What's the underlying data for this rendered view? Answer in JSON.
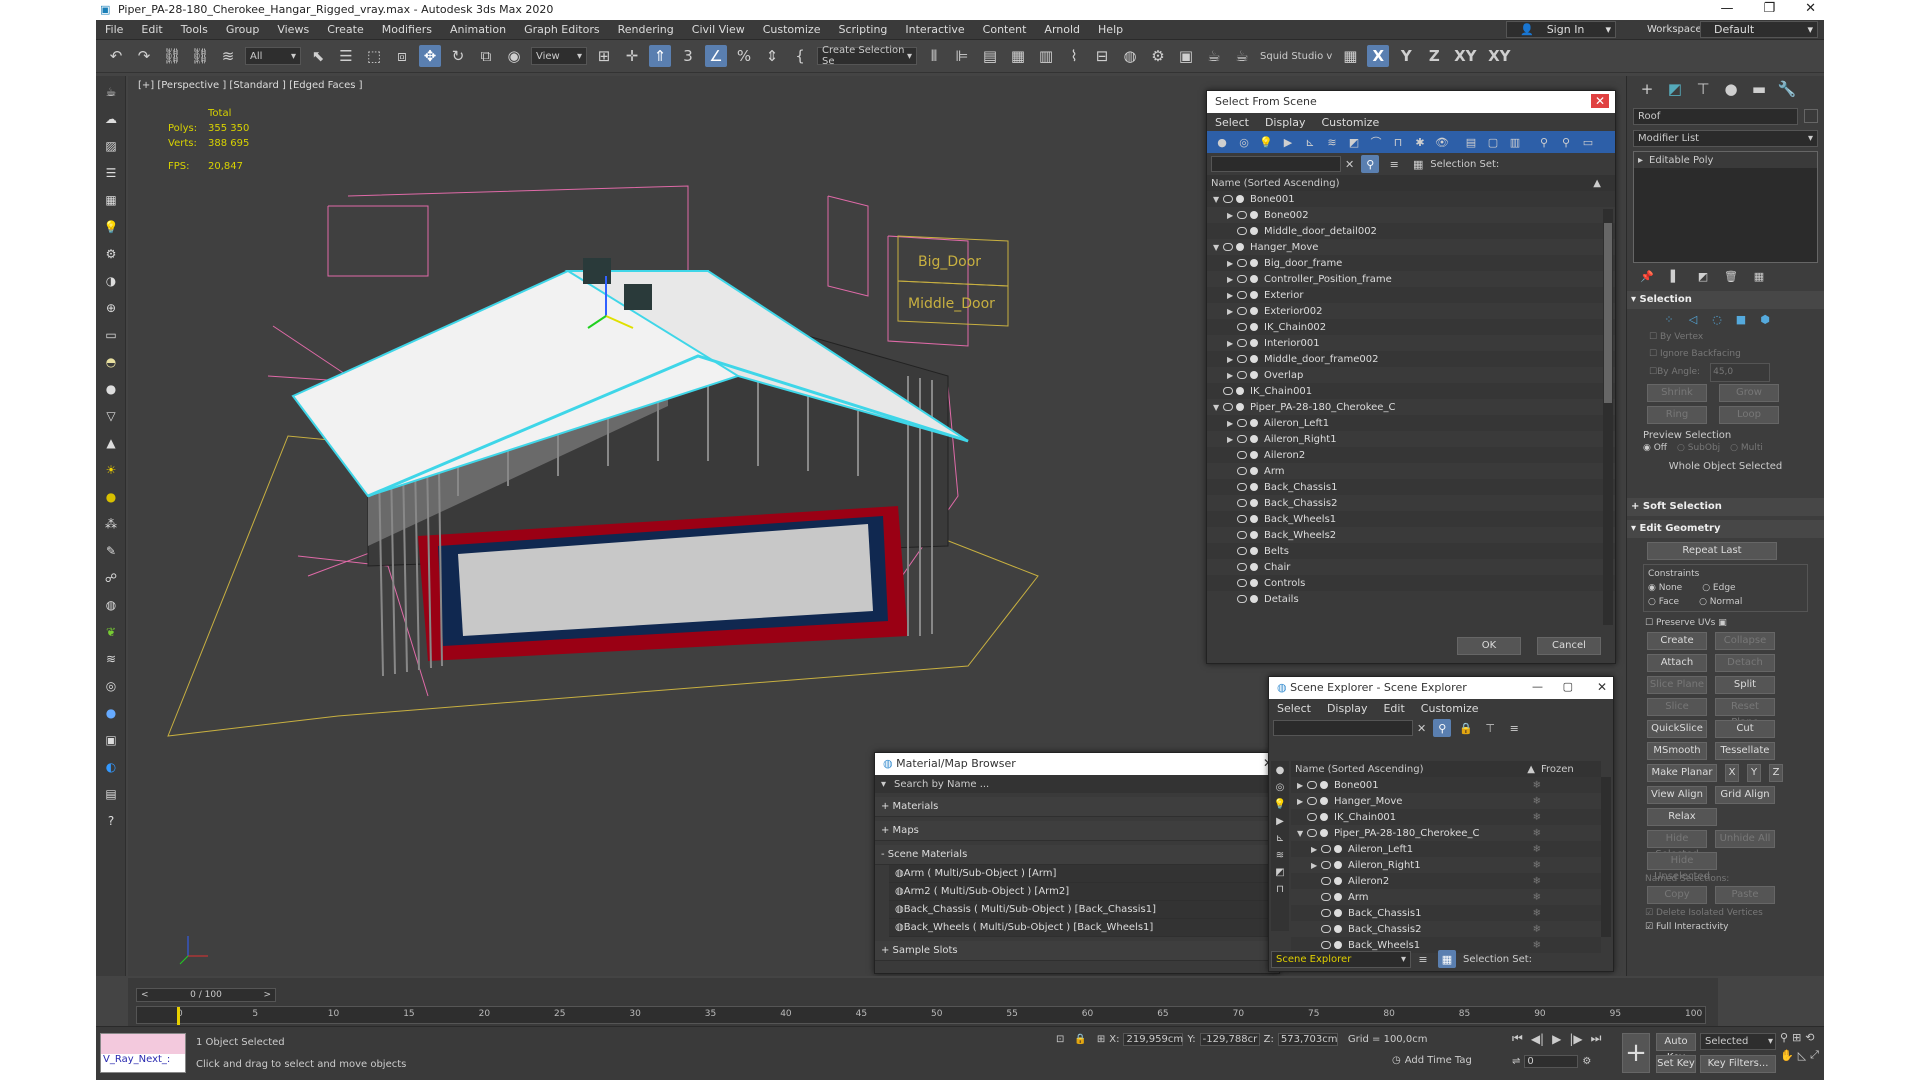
{
  "window": {
    "title": "Piper_PA-28-180_Cherokee_Hangar_Rigged_vray.max - Autodesk 3ds Max 2020"
  },
  "menu": [
    "File",
    "Edit",
    "Tools",
    "Group",
    "Views",
    "Create",
    "Modifiers",
    "Animation",
    "Graph Editors",
    "Rendering",
    "Civil View",
    "Customize",
    "Scripting",
    "Interactive",
    "Content",
    "Arnold",
    "Help"
  ],
  "signin": "Sign In",
  "workspaces_label": "Workspaces:",
  "workspace": "Default",
  "toolbar": {
    "filter": "All",
    "view": "View",
    "selection_set": "Create Selection Se",
    "squid": "Squid Studio v",
    "axes": [
      "X",
      "Y",
      "Z",
      "XY",
      "XY"
    ]
  },
  "viewport": {
    "label": "[+] [Perspective ] [Standard ] [Edged Faces ]",
    "stats_total": "Total",
    "polys_label": "Polys:",
    "polys": "355 350",
    "verts_label": "Verts:",
    "verts": "388 695",
    "fps_label": "FPS:",
    "fps": "20,847",
    "sign1": "Big_Door",
    "sign2": "Middle_Door"
  },
  "select_scene": {
    "title": "Select From Scene",
    "menu": [
      "Select",
      "Display",
      "Customize"
    ],
    "selection_set_label": "Selection Set:",
    "header": "Name (Sorted Ascending)",
    "items": [
      {
        "name": "Bone001",
        "lvl": 0,
        "exp": "open"
      },
      {
        "name": "Bone002",
        "lvl": 1,
        "exp": "closed"
      },
      {
        "name": "Middle_door_detail002",
        "lvl": 1,
        "exp": ""
      },
      {
        "name": "Hanger_Move",
        "lvl": 0,
        "exp": "open"
      },
      {
        "name": "Big_door_frame",
        "lvl": 1,
        "exp": "closed"
      },
      {
        "name": "Controller_Position_frame",
        "lvl": 1,
        "exp": "closed"
      },
      {
        "name": "Exterior",
        "lvl": 1,
        "exp": "closed"
      },
      {
        "name": "Exterior002",
        "lvl": 1,
        "exp": "closed"
      },
      {
        "name": "IK_Chain002",
        "lvl": 1,
        "exp": ""
      },
      {
        "name": "Interior001",
        "lvl": 1,
        "exp": "closed"
      },
      {
        "name": "Middle_door_frame002",
        "lvl": 1,
        "exp": "closed"
      },
      {
        "name": "Overlap",
        "lvl": 1,
        "exp": "closed"
      },
      {
        "name": "IK_Chain001",
        "lvl": 0,
        "exp": ""
      },
      {
        "name": "Piper_PA-28-180_Cherokee_C",
        "lvl": 0,
        "exp": "open"
      },
      {
        "name": "Aileron_Left1",
        "lvl": 1,
        "exp": "closed"
      },
      {
        "name": "Aileron_Right1",
        "lvl": 1,
        "exp": "closed"
      },
      {
        "name": "Aileron2",
        "lvl": 1,
        "exp": ""
      },
      {
        "name": "Arm",
        "lvl": 1,
        "exp": ""
      },
      {
        "name": "Back_Chassis1",
        "lvl": 1,
        "exp": ""
      },
      {
        "name": "Back_Chassis2",
        "lvl": 1,
        "exp": ""
      },
      {
        "name": "Back_Wheels1",
        "lvl": 1,
        "exp": ""
      },
      {
        "name": "Back_Wheels2",
        "lvl": 1,
        "exp": ""
      },
      {
        "name": "Belts",
        "lvl": 1,
        "exp": ""
      },
      {
        "name": "Chair",
        "lvl": 1,
        "exp": ""
      },
      {
        "name": "Controls",
        "lvl": 1,
        "exp": ""
      },
      {
        "name": "Details",
        "lvl": 1,
        "exp": ""
      }
    ],
    "ok": "OK",
    "cancel": "Cancel"
  },
  "scene_explorer": {
    "title": "Scene Explorer - Scene Explorer",
    "menu": [
      "Select",
      "Display",
      "Edit",
      "Customize"
    ],
    "header": "Name (Sorted Ascending)",
    "frozen": "Frozen",
    "items": [
      {
        "name": "Bone001",
        "lvl": 0,
        "exp": "closed"
      },
      {
        "name": "Hanger_Move",
        "lvl": 0,
        "exp": "closed"
      },
      {
        "name": "IK_Chain001",
        "lvl": 0,
        "exp": ""
      },
      {
        "name": "Piper_PA-28-180_Cherokee_C",
        "lvl": 0,
        "exp": "open"
      },
      {
        "name": "Aileron_Left1",
        "lvl": 1,
        "exp": "closed"
      },
      {
        "name": "Aileron_Right1",
        "lvl": 1,
        "exp": "closed"
      },
      {
        "name": "Aileron2",
        "lvl": 1,
        "exp": ""
      },
      {
        "name": "Arm",
        "lvl": 1,
        "exp": ""
      },
      {
        "name": "Back_Chassis1",
        "lvl": 1,
        "exp": ""
      },
      {
        "name": "Back_Chassis2",
        "lvl": 1,
        "exp": ""
      },
      {
        "name": "Back_Wheels1",
        "lvl": 1,
        "exp": ""
      }
    ],
    "footer": "Scene Explorer",
    "selection_set_label": "Selection Set:"
  },
  "material_browser": {
    "title": "Material/Map Browser",
    "search": "Search by Name ...",
    "groups": [
      "+ Materials",
      "+ Maps",
      "- Scene Materials"
    ],
    "materials": [
      "Arm  ( Multi/Sub-Object ) [Arm]",
      "Arm2  ( Multi/Sub-Object ) [Arm2]",
      "Back_Chassis  ( Multi/Sub-Object ) [Back_Chassis1]",
      "Back_Wheels  ( Multi/Sub-Object ) [Back_Wheels1]"
    ],
    "sample": "+ Sample Slots"
  },
  "command_panel": {
    "object_name": "Roof",
    "modifier_list": "Modifier List",
    "stack_item": "Editable Poly",
    "selection": "Selection",
    "by_vertex": "By Vertex",
    "ignore_backfacing": "Ignore Backfacing",
    "by_angle": "By Angle:",
    "angle": "45,0",
    "shrink": "Shrink",
    "grow": "Grow",
    "ring": "Ring",
    "loop": "Loop",
    "preview_selection": "Preview Selection",
    "preview_opts": [
      "Off",
      "SubObj",
      "Multi"
    ],
    "whole_object": "Whole Object Selected",
    "soft_selection": "Soft Selection",
    "edit_geometry": "Edit Geometry",
    "repeat_last": "Repeat Last",
    "constraints": "Constraints",
    "c_opts": [
      "None",
      "Edge",
      "Face",
      "Normal"
    ],
    "preserve_uvs": "Preserve UVs",
    "create": "Create",
    "collapse": "Collapse",
    "attach": "Attach",
    "detach": "Detach",
    "slice_plane": "Slice Plane",
    "split": "Split",
    "slice": "Slice",
    "reset_plane": "Reset Plane",
    "quickslice": "QuickSlice",
    "cut": "Cut",
    "msmooth": "MSmooth",
    "tessellate": "Tessellate",
    "make_planar": "Make Planar",
    "x": "X",
    "y": "Y",
    "z": "Z",
    "view_align": "View Align",
    "grid_align": "Grid Align",
    "relax": "Relax",
    "hide_selected": "Hide Selected",
    "unhide_all": "Unhide All",
    "hide_unselected": "Hide Unselected",
    "named_selections": "Named Selections:",
    "copy": "Copy",
    "paste": "Paste",
    "delete_isolated": "Delete Isolated Vertices",
    "full_interactivity": "Full Interactivity"
  },
  "timeline": {
    "frame": "0 / 100",
    "ticks": [
      "0",
      "5",
      "10",
      "15",
      "20",
      "25",
      "30",
      "35",
      "40",
      "45",
      "50",
      "55",
      "60",
      "65",
      "70",
      "75",
      "80",
      "85",
      "90",
      "95",
      "100"
    ],
    "progress": 0
  },
  "status": {
    "script": "V_Ray_Next_:",
    "selected": "1 Object Selected",
    "hint": "Click and drag to select and move objects",
    "x_label": "X:",
    "x": "219,959cm",
    "y_label": "Y:",
    "y": "-129,788cr",
    "z_label": "Z:",
    "z": "573,703cm",
    "grid": "Grid = 100,0cm",
    "add_time_tag": "Add Time Tag",
    "frame": "0",
    "auto_key": "Auto Key",
    "set_key": "Set Key",
    "selected_dd": "Selected",
    "key_filters": "Key Filters..."
  },
  "colors": {
    "accent": "#5a7fb0",
    "selection": "#3fd6e8",
    "helper": "#e06aa8",
    "sign": "#d8c000"
  }
}
